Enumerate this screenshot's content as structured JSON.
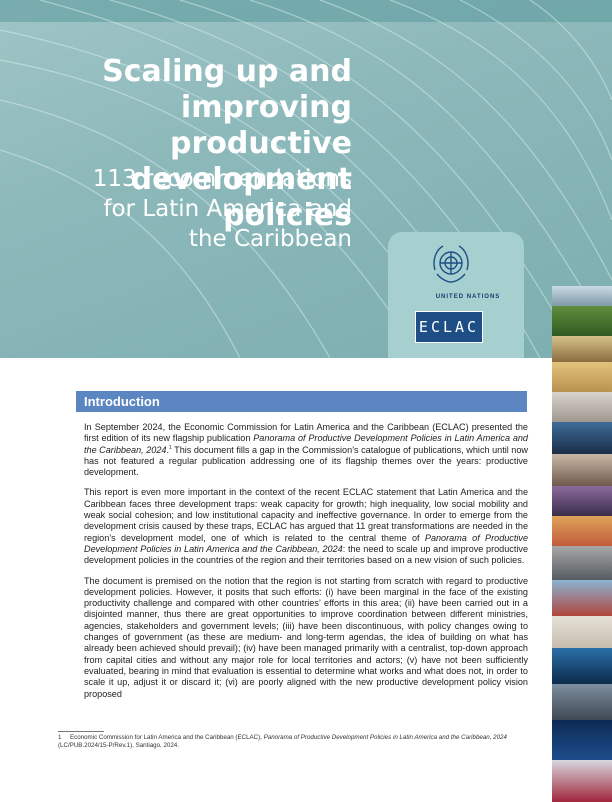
{
  "cover": {
    "title_lines": [
      "Scaling up and",
      "improving productive",
      "development policies"
    ],
    "subtitle_lines": [
      "113 recommendations",
      "for Latin America and",
      "the Caribbean"
    ]
  },
  "logos": {
    "un_text": "UNITED NATIONS",
    "eclac_text": "ECLAC",
    "emblem_icon": "un-emblem-icon"
  },
  "section": {
    "heading": "Introduction"
  },
  "paragraphs": {
    "p1": {
      "a": "In September 2024, the Economic Commission for Latin America and the Caribbean (ECLAC) presented the first edition of its new flagship publication ",
      "italic": "Panorama of Productive Development Policies in Latin America and the Caribbean, 2024",
      "dot": ".",
      "sup": "1",
      "b": " This document fills a gap in the Commission’s catalogue of publications, which until now has not featured a regular publication addressing one of its flagship themes over the years: productive development."
    },
    "p2": {
      "a": "This report is even more important in the context of the recent ECLAC statement that Latin America and the Caribbean faces three development traps: weak capacity for growth; high inequality, low social mobility and weak social cohesion; and low institutional capacity and ineffective governance. In order to emerge from the development crisis caused by these traps, ECLAC has argued that 11 great transformations are needed in the region’s development model, one of which is related to the central theme of ",
      "italic": "Panorama of Productive Development Policies in Latin America and the Caribbean, 2024",
      "b": ": the need to scale up and improve productive development policies in the countries of the region and their territories based on a new vision of such policies."
    },
    "p3": "The document is premised on the notion that the region is not starting from scratch with regard to productive development policies. However, it posits that such efforts: (i) have been marginal in the face of the existing productivity challenge and compared with other countries’ efforts in this area; (ii) have been carried out in a disjointed manner, thus there are great opportunities to improve coordination between different ministries, agencies, stakeholders and government levels; (iii) have been discontinuous, with policy changes owing to changes of government (as these are medium- and long-term agendas, the idea of building on what has already been achieved should prevail); (iv) have been managed primarily with a centralist, top-down approach from capital cities and without any major role for local territories and actors; (v) have not been sufficiently evaluated, bearing in mind that evaluation is essential to determine what works and what does not, in order to scale it up, adjust it or discard it; (vi) are poorly aligned with the new productive development policy vision proposed"
  },
  "footnote": {
    "number": "1",
    "a": "Economic Commission for Latin America and the Caribbean (ECLAC), ",
    "italic": "Panorama of Productive Development Policies in Latin America and the Caribbean, 2024",
    "b": " (LC/PUB.2024/15-P/Rev.1), Santiago, 2024."
  },
  "photo_strip": {
    "tiles": [
      "industry-photo",
      "agriculture-photo",
      "retail-photo",
      "colonial-street-photo",
      "laptop-work-photo",
      "technology-photo",
      "meeting-photo",
      "textile-photo",
      "teamwork-hands-photo",
      "industrial-equipment-photo",
      "port-containers-photo",
      "robot-arm-photo",
      "digital-network-photo",
      "crowd-photo",
      "satellite-earth-photo",
      "world-map-photo"
    ]
  }
}
